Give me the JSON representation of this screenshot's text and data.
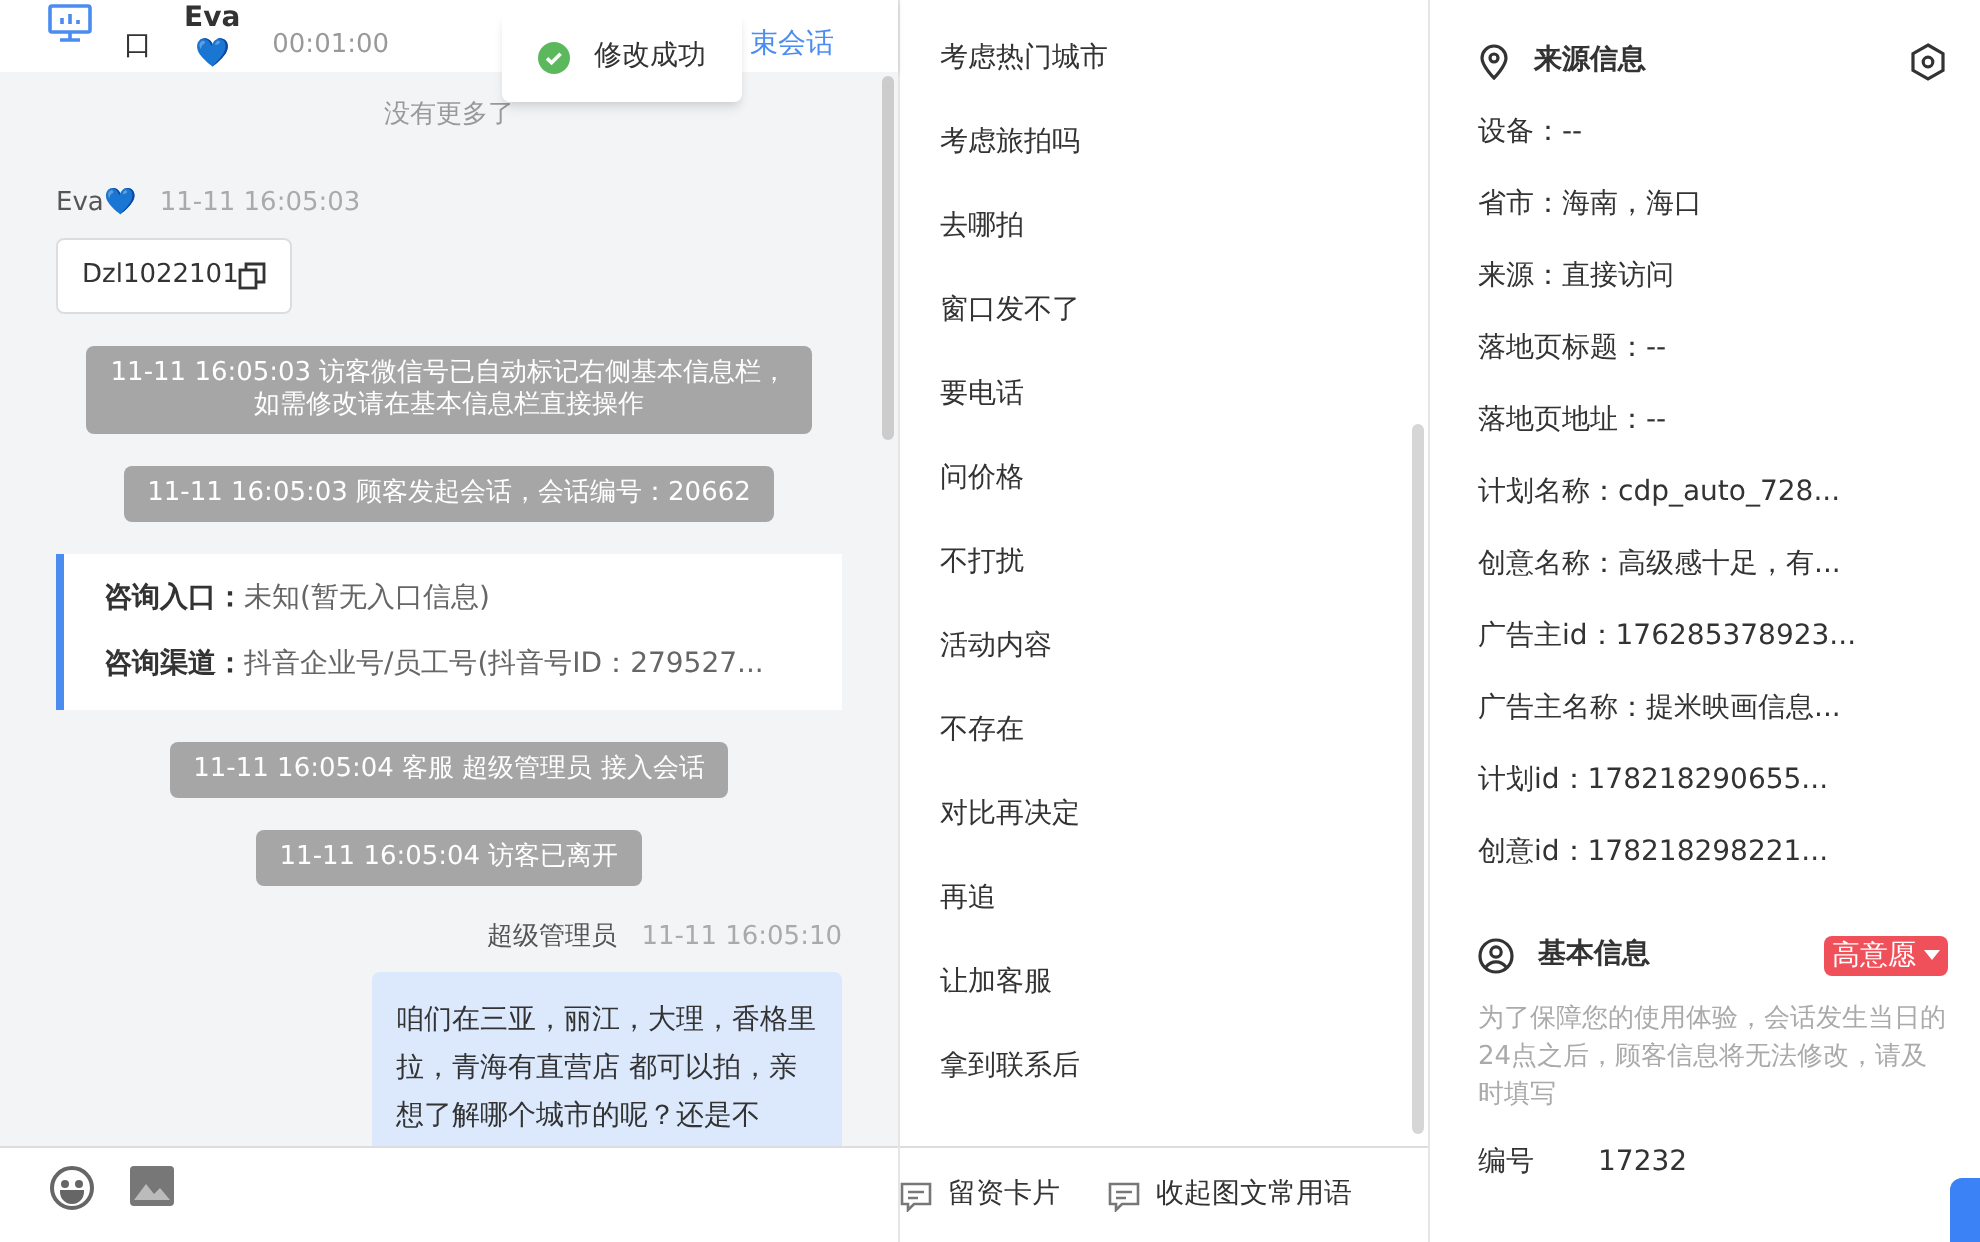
{
  "header": {
    "location": [
      "口"
    ],
    "visitor": "Eva",
    "heart": "💙",
    "time": "00:01:00",
    "end_session": "束会话"
  },
  "toast": {
    "text": "修改成功"
  },
  "chat": {
    "no_more": "没有更多了",
    "messages": [
      {
        "kind": "visitor",
        "name": "Eva",
        "heart": "💙",
        "time": "11-11 16:05:03",
        "text": "Dzl1022101"
      },
      {
        "kind": "system",
        "lines": [
          "11-11 16:05:03 访客微信号已自动标记右侧基本信息栏，",
          "如需修改请在基本信息栏直接操作"
        ]
      },
      {
        "kind": "system",
        "lines": [
          "11-11 16:05:03 顾客发起会话，会话编号：20662"
        ]
      },
      {
        "kind": "info",
        "rows": [
          {
            "label": "咨询入口：",
            "value": "未知(暂无入口信息)"
          },
          {
            "label": "咨询渠道：",
            "value": "抖音企业号/员工号(抖音号ID：279527..."
          }
        ]
      },
      {
        "kind": "system",
        "lines": [
          "11-11 16:05:04 客服 超级管理员 接入会话"
        ]
      },
      {
        "kind": "system",
        "lines": [
          "11-11 16:05:04 访客已离开"
        ]
      },
      {
        "kind": "agent",
        "name": "超级管理员",
        "time": "11-11 16:05:10",
        "text": "咱们在三亚，丽江，大理，香格里拉，青海有直营店 都可以拍，亲想了解哪个城市的呢？还是不"
      }
    ]
  },
  "phrases": [
    "考虑热门城市",
    "考虑旅拍吗",
    "去哪拍",
    "窗口发不了",
    "要电话",
    "问价格",
    "不打扰",
    "活动内容",
    "不存在",
    "对比再决定",
    "再追",
    "让加客服",
    "拿到联系后"
  ],
  "phrase_actions": [
    "留资卡片",
    "收起图文常用语"
  ],
  "source_info": {
    "title": "来源信息",
    "rows": [
      "设备：--",
      "省市：海南，海口",
      "来源：直接访问",
      "落地页标题：--",
      "落地页地址：--",
      "计划名称：cdp_auto_728...",
      "创意名称：高级感十足，有...",
      "广告主id：176285378923...",
      "广告主名称：提米映画信息...",
      "计划id：178218290655...",
      "创意id：178218298221..."
    ]
  },
  "basic_info": {
    "title": "基本信息",
    "tag": "高意愿",
    "notice": "为了保障您的使用体验，会话发生当日的24点之后，顾客信息将无法修改，请及时填写",
    "fields": [
      {
        "label": "编号",
        "value": "17232"
      }
    ]
  }
}
